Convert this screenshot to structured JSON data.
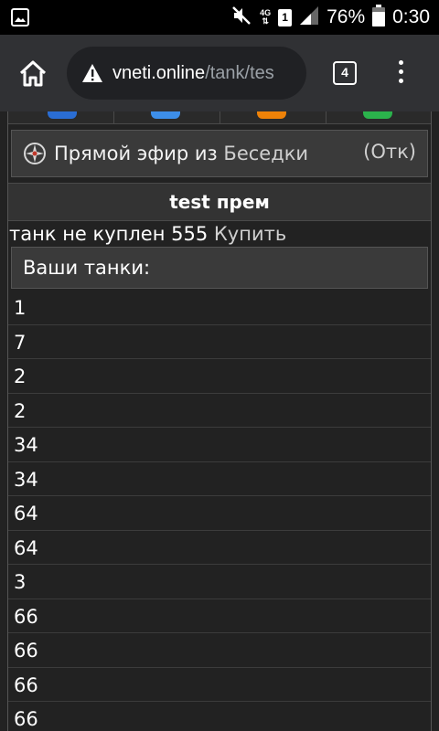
{
  "status_bar": {
    "network": "4G",
    "sim": "1",
    "battery": "76%",
    "time": "0:30",
    "icons": [
      "image-icon",
      "mute-icon",
      "signal-icon",
      "battery-icon"
    ]
  },
  "browser": {
    "url_host": "vneti.online",
    "url_path": "/tank/tes",
    "tab_count": "4",
    "icons": [
      "home-icon",
      "warning-icon",
      "menu-icon"
    ]
  },
  "live_box": {
    "prefix": "Прямой эфир из",
    "link": "Беседки",
    "close": "(Отк)"
  },
  "page": {
    "title": "test прем",
    "tank_status": "танк не куплен 555",
    "buy_link": "Купить",
    "my_tanks_label": "Ваши танки:"
  },
  "tank_list": [
    "1",
    "7",
    "2",
    "2",
    "34",
    "34",
    "64",
    "64",
    "3",
    "66",
    "66",
    "66",
    "66"
  ],
  "colors": {
    "social_1": "#2a6dd3",
    "social_2": "#3d8ee8",
    "social_3": "#ee8208",
    "social_4": "#2bb24c"
  }
}
